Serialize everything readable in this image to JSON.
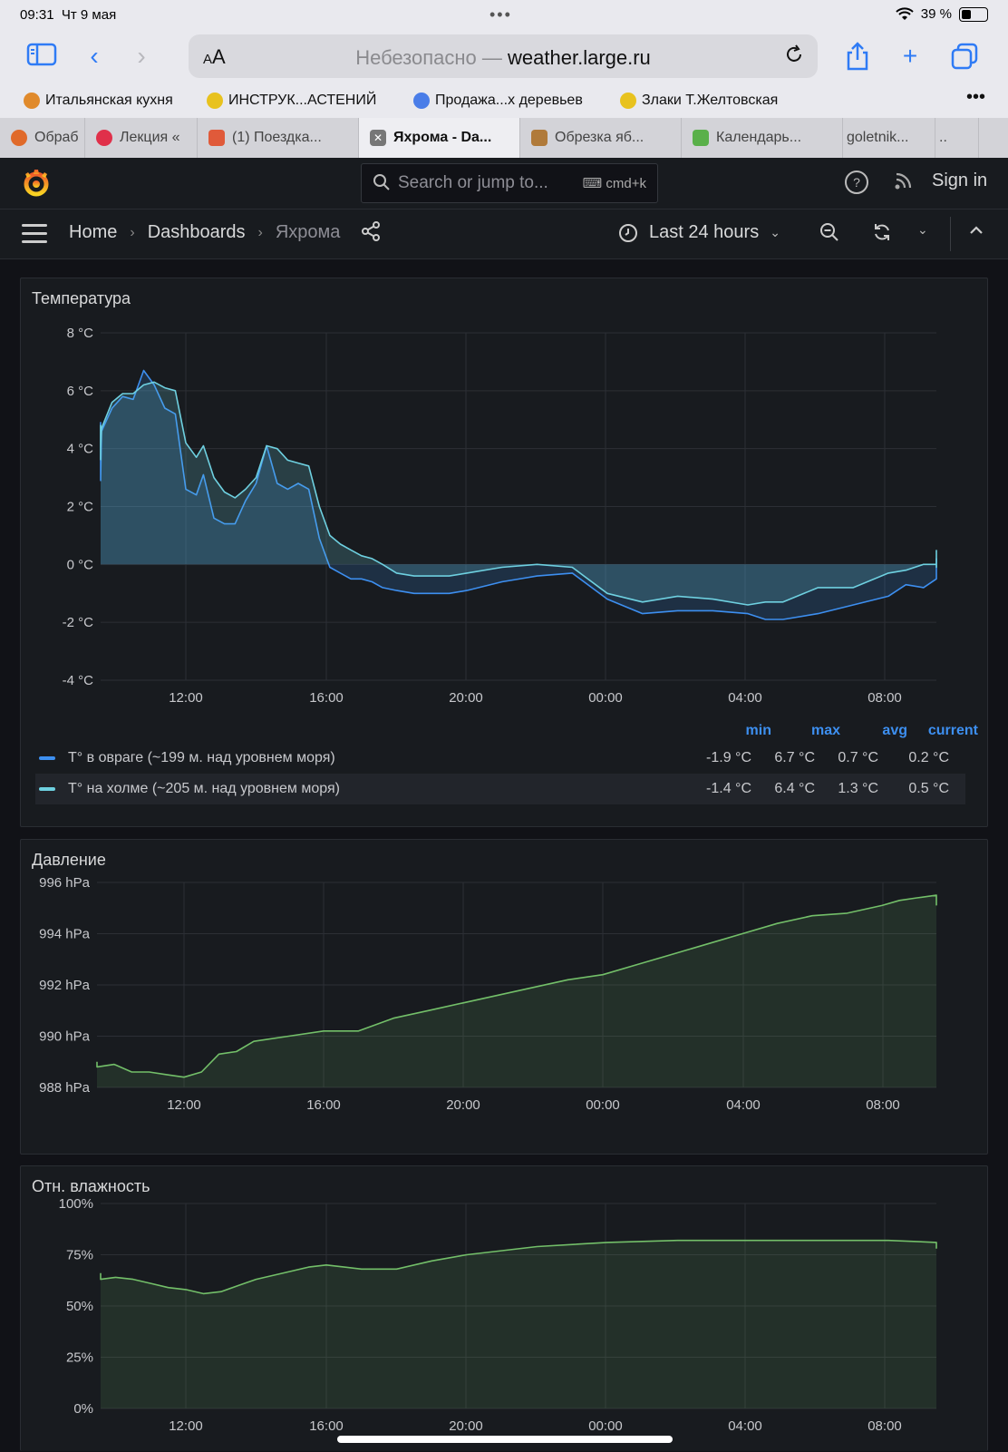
{
  "status_bar": {
    "time": "09:31",
    "date": "Чт 9 мая",
    "battery": "39 %",
    "battery_fraction": 0.39
  },
  "browser": {
    "url_prefix": "Небезопасно — ",
    "url_host": "weather.large.ru",
    "reader_label": "AA",
    "bookmarks": [
      {
        "label": "Итальянская кухня",
        "color": "#e08a2c"
      },
      {
        "label": "ИНСТРУК...АСТЕНИЙ",
        "color": "#e8c21e"
      },
      {
        "label": "Продажа...х деревьев",
        "color": "#4a7de8"
      },
      {
        "label": "Злаки Т.Желтовская",
        "color": "#e8c21e"
      }
    ],
    "more_label": "•••",
    "tabs": [
      {
        "label": "Обраб",
        "color": "#e06a2a"
      },
      {
        "label": "Лекция «",
        "color": "#e0304a"
      },
      {
        "label": "(1) Поездка...",
        "color": "#e05a3a"
      },
      {
        "label": "Яхрома - Da...",
        "color": "#666666",
        "active": true
      },
      {
        "label": "Обрезка яб...",
        "color": "#b07a3a"
      },
      {
        "label": "Календарь...",
        "color": "#5ab04a"
      },
      {
        "label": "goletnik...",
        "color": ""
      },
      {
        "label": "..",
        "color": ""
      }
    ]
  },
  "grafana": {
    "search_placeholder": "Search or jump to...",
    "search_shortcut": "cmd+k",
    "help_label": "?",
    "sign_in": "Sign in",
    "breadcrumbs": [
      "Home",
      "Dashboards",
      "Яхрома"
    ],
    "time_range": "Last 24 hours",
    "accent": "#3d8ff0"
  },
  "panels": {
    "temperature": {
      "title": "Температура",
      "legend_headers": [
        "min",
        "max",
        "avg",
        "current"
      ],
      "legend_rows": [
        {
          "name": "T° в овраге (~199 м. над уровнем моря)",
          "color": "#3d8ff0",
          "min": "-1.9 °C",
          "max": "6.7 °C",
          "avg": "0.7 °C",
          "current": "0.2 °C"
        },
        {
          "name": "T° на холме (~205 м. над уровнем моря)",
          "color": "#6ed0e0",
          "min": "-1.4 °C",
          "max": "6.4 °C",
          "avg": "1.3 °C",
          "current": "0.5 °C"
        }
      ]
    },
    "pressure": {
      "title": "Давление"
    },
    "humidity": {
      "title": "Отн. влажность"
    }
  },
  "chart_data": [
    {
      "type": "line",
      "title": "Температура",
      "x_ticks": [
        "12:00",
        "16:00",
        "20:00",
        "00:00",
        "04:00",
        "08:00"
      ],
      "y_ticks": [
        "8 °C",
        "6 °C",
        "4 °C",
        "2 °C",
        "0 °C",
        "-2 °C",
        "-4 °C"
      ],
      "ylim": [
        -4,
        8
      ],
      "x_hours_from_noon": [
        -3.7,
        -3.4,
        -3.0,
        -2.7,
        -2.4,
        -2.1,
        -1.8,
        -1.5,
        -1.2,
        -0.9,
        -0.6,
        -0.3,
        0,
        0.3,
        0.5,
        0.8,
        1.1,
        1.4,
        1.7,
        2.0,
        2.3,
        2.6,
        2.9,
        3.2,
        3.5,
        3.8,
        4.1,
        4.4,
        4.7,
        5.0,
        5.3,
        5.6,
        6.0,
        6.5,
        7.0,
        7.5,
        8.0,
        9.0,
        10.0,
        11.0,
        12.0,
        13.0,
        14.0,
        15.0,
        16.0,
        16.5,
        17.0,
        18.0,
        19.0,
        20.0,
        20.5,
        21.0,
        21.5,
        22.0,
        22.3,
        23.0,
        23.7,
        24.0,
        24.3
      ],
      "series": [
        {
          "name": "T° в овраге (~199 м. над уровнем моря)",
          "values": [
            3.1,
            4.5,
            4.9,
            2.9,
            4.6,
            5.4,
            5.8,
            5.7,
            6.7,
            6.2,
            5.4,
            5.2,
            2.6,
            2.4,
            3.1,
            1.6,
            1.4,
            1.4,
            2.2,
            2.8,
            4.1,
            2.8,
            2.6,
            2.8,
            2.6,
            0.9,
            -0.1,
            -0.3,
            -0.5,
            -0.5,
            -0.6,
            -0.8,
            -0.9,
            -1.0,
            -1.0,
            -1.0,
            -0.9,
            -0.6,
            -0.4,
            -0.3,
            -1.2,
            -1.7,
            -1.6,
            -1.6,
            -1.7,
            -1.9,
            -1.9,
            -1.7,
            -1.4,
            -1.1,
            -0.7,
            -0.8,
            -0.5,
            -0.3,
            -0.5,
            0.2,
            0.2,
            0.1,
            0.2
          ]
        },
        {
          "name": "T° на холме (~205 м. над уровнем моря)",
          "values": [
            3.6,
            4.4,
            4.8,
            4.0,
            4.7,
            5.6,
            5.9,
            5.9,
            6.2,
            6.3,
            6.1,
            6.0,
            4.2,
            3.7,
            4.1,
            3.0,
            2.5,
            2.3,
            2.6,
            3.0,
            4.1,
            4.0,
            3.6,
            3.5,
            3.4,
            2.0,
            1.0,
            0.7,
            0.5,
            0.3,
            0.2,
            0.0,
            -0.3,
            -0.4,
            -0.4,
            -0.4,
            -0.3,
            -0.1,
            0.0,
            -0.1,
            -1.0,
            -1.3,
            -1.1,
            -1.2,
            -1.4,
            -1.3,
            -1.3,
            -0.8,
            -0.8,
            -0.3,
            -0.2,
            0.0,
            0.0,
            0.1,
            -0.1,
            0.3,
            0.4,
            0.5,
            0.5
          ]
        }
      ]
    },
    {
      "type": "area",
      "title": "Давление",
      "x_ticks": [
        "12:00",
        "16:00",
        "20:00",
        "00:00",
        "04:00",
        "08:00"
      ],
      "y_ticks": [
        "996 hPa",
        "994 hPa",
        "992 hPa",
        "990 hPa",
        "988 hPa"
      ],
      "ylim": [
        988,
        996
      ],
      "x_hours_from_noon": [
        -3.7,
        -3.0,
        -2.0,
        -1.5,
        -1.0,
        -0.5,
        0,
        0.5,
        1.0,
        1.5,
        2.0,
        3.0,
        4.0,
        5.0,
        6.0,
        7.0,
        8.0,
        9.0,
        10.0,
        11.0,
        12.0,
        13.0,
        14.0,
        15.0,
        16.0,
        17.0,
        18.0,
        19.0,
        20.0,
        20.5,
        21.0,
        22.0,
        23.0,
        24.0
      ],
      "series": [
        {
          "name": "",
          "values": [
            989.0,
            988.8,
            988.9,
            988.6,
            988.6,
            988.5,
            988.4,
            988.6,
            989.3,
            989.4,
            989.8,
            990.0,
            990.2,
            990.2,
            990.7,
            991.0,
            991.3,
            991.6,
            991.9,
            992.2,
            992.4,
            992.8,
            993.2,
            993.6,
            994.0,
            994.4,
            994.7,
            994.8,
            995.1,
            995.3,
            995.4,
            995.5,
            995.5,
            995.1
          ]
        }
      ]
    },
    {
      "type": "area",
      "title": "Отн. влажность",
      "x_ticks": [
        "12:00",
        "16:00",
        "20:00",
        "00:00",
        "04:00",
        "08:00"
      ],
      "y_ticks": [
        "100%",
        "75%",
        "50%",
        "25%",
        "0%"
      ],
      "ylim": [
        0,
        100
      ],
      "x_hours_from_noon": [
        -3.7,
        -3.0,
        -2.5,
        -2.0,
        -1.5,
        -1.0,
        -0.5,
        0,
        0.5,
        1.0,
        1.5,
        2.0,
        2.5,
        3.0,
        3.5,
        4.0,
        5.0,
        6.0,
        7.0,
        8.0,
        9.0,
        10.0,
        12.0,
        14.0,
        16.0,
        18.0,
        20.0,
        22.0,
        24.0
      ],
      "series": [
        {
          "name": "",
          "values": [
            66,
            64,
            63,
            64,
            63,
            61,
            59,
            58,
            56,
            57,
            60,
            63,
            65,
            67,
            69,
            70,
            68,
            68,
            72,
            75,
            77,
            79,
            81,
            82,
            82,
            82,
            82,
            81,
            78
          ]
        }
      ]
    }
  ]
}
